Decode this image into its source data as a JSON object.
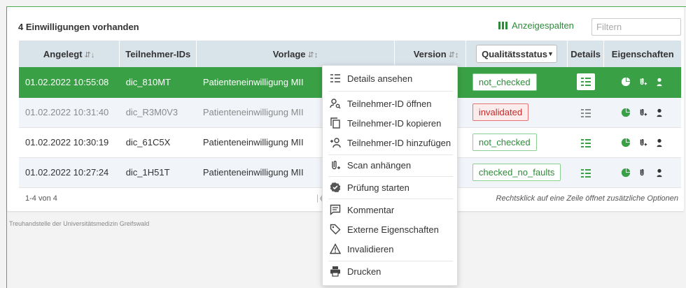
{
  "header": {
    "title": "4 Einwilligungen vorhanden",
    "columns_label": "Anzeigespalten",
    "filter_placeholder": "Filtern"
  },
  "table": {
    "headers": [
      "Angelegt",
      "Teilnehmer-IDs",
      "Vorlage",
      "Version",
      "Qualitätsstatus",
      "Details",
      "Eigenschaften"
    ],
    "rows": [
      {
        "created": "01.02.2022 10:55:08",
        "participant": "dic_810MT",
        "template": "Patienteneinwilligung MII",
        "status": "not_checked"
      },
      {
        "created": "01.02.2022 10:31:40",
        "participant": "dic_R3M0V3",
        "template": "Patienteneinwilligung MII",
        "status": "invalidated"
      },
      {
        "created": "01.02.2022 10:30:19",
        "participant": "dic_61C5X",
        "template": "Patienteneinwilligung MII",
        "status": "not_checked"
      },
      {
        "created": "01.02.2022 10:27:24",
        "participant": "dic_1H51T",
        "template": "Patienteneinwilligung MII",
        "status": "checked_no_faults"
      }
    ]
  },
  "pager": {
    "range": "1-4 von 4",
    "first_icon": "first-page-icon"
  },
  "hint": "Rechtsklick auf eine Zeile öffnet zusätzliche Optionen",
  "footer": "Treuhandstelle der Universitätsmedizin Greifswald",
  "context_menu": {
    "items": [
      {
        "label": "Details ansehen",
        "icon": "details-icon"
      },
      {
        "label": "Teilnehmer-ID öffnen",
        "icon": "person-search-icon"
      },
      {
        "label": "Teilnehmer-ID kopieren",
        "icon": "copy-icon"
      },
      {
        "label": "Teilnehmer-ID hinzufügen",
        "icon": "person-add-icon"
      },
      {
        "label": "Scan anhängen",
        "icon": "attach-icon"
      },
      {
        "label": "Prüfung starten",
        "icon": "verified-badge-icon"
      },
      {
        "label": "Kommentar",
        "icon": "comment-icon"
      },
      {
        "label": "Externe Eigenschaften",
        "icon": "tag-icon"
      },
      {
        "label": "Invalidieren",
        "icon": "warning-icon"
      },
      {
        "label": "Drucken",
        "icon": "print-icon"
      }
    ]
  },
  "colors": {
    "accent": "#3aa046",
    "header_bg": "#d9e3ea",
    "invalid": "#c62828"
  }
}
